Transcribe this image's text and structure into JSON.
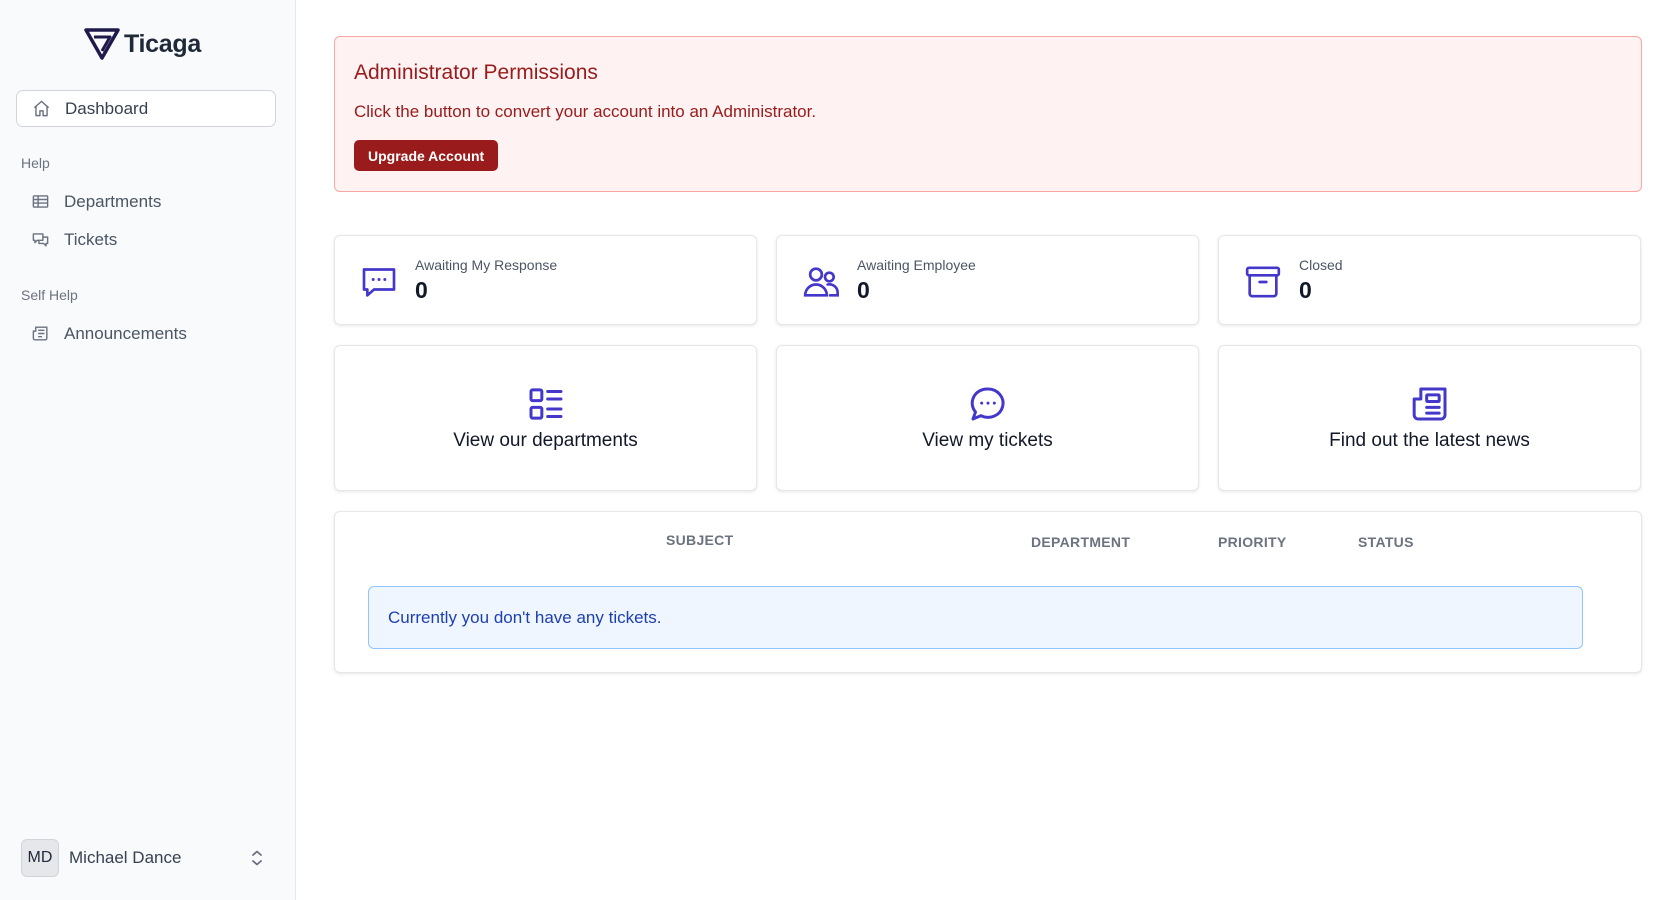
{
  "app": {
    "name": "Ticaga",
    "brand_color": "#1e1b4b",
    "accent_color": "#4338ca"
  },
  "sidebar": {
    "dashboard": {
      "label": "Dashboard",
      "icon": "home-icon"
    },
    "help_section": "Help",
    "help_items": [
      {
        "label": "Departments",
        "icon": "table-icon"
      },
      {
        "label": "Tickets",
        "icon": "chat-bubbles-icon"
      }
    ],
    "self_help_section": "Self Help",
    "self_help_items": [
      {
        "label": "Announcements",
        "icon": "newspaper-icon"
      }
    ],
    "user": {
      "initials": "MD",
      "name": "Michael Dance"
    }
  },
  "alert": {
    "title": "Administrator Permissions",
    "text": "Click the button to convert your account into an Administrator.",
    "button": "Upgrade Account",
    "color": "#991b1b"
  },
  "stats": [
    {
      "label": "Awaiting My Response",
      "value": "0",
      "icon": "chat-dots-icon"
    },
    {
      "label": "Awaiting Employee",
      "value": "0",
      "icon": "users-icon"
    },
    {
      "label": "Closed",
      "value": "0",
      "icon": "archive-icon"
    }
  ],
  "actions": [
    {
      "label": "View our departments",
      "icon": "list-icon"
    },
    {
      "label": "View my tickets",
      "icon": "chat-bubble-icon"
    },
    {
      "label": "Find out the latest news",
      "icon": "newspaper-icon"
    }
  ],
  "tickets_table": {
    "columns": [
      "SUBJECT",
      "DEPARTMENT",
      "PRIORITY",
      "STATUS"
    ],
    "empty_message": "Currently you don't have any tickets."
  }
}
